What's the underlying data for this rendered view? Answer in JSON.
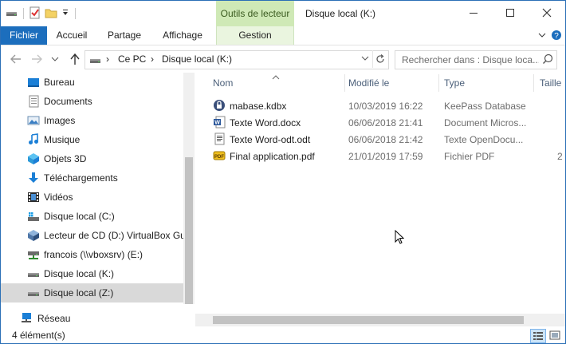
{
  "title_bar": {
    "context_tab": "Outils de lecteur",
    "window_title": "Disque local (K:)",
    "qat_icons": [
      "drive-icon",
      "properties-check-icon",
      "new-folder-icon",
      "customize-qat-icon"
    ]
  },
  "ribbon": {
    "tabs": [
      {
        "label": "Fichier"
      },
      {
        "label": "Accueil"
      },
      {
        "label": "Partage"
      },
      {
        "label": "Affichage"
      },
      {
        "label": "Gestion"
      }
    ]
  },
  "address": {
    "crumbs": [
      "Ce PC",
      "Disque local (K:)"
    ],
    "search_placeholder": "Rechercher dans : Disque loca..."
  },
  "nav_pane": {
    "items": [
      {
        "label": "Bureau",
        "icon": "desktop-icon"
      },
      {
        "label": "Documents",
        "icon": "documents-icon"
      },
      {
        "label": "Images",
        "icon": "images-icon"
      },
      {
        "label": "Musique",
        "icon": "music-icon"
      },
      {
        "label": "Objets 3D",
        "icon": "3d-objects-icon"
      },
      {
        "label": "Téléchargements",
        "icon": "downloads-icon"
      },
      {
        "label": "Vidéos",
        "icon": "videos-icon"
      },
      {
        "label": "Disque local (C:)",
        "icon": "windows-drive-icon"
      },
      {
        "label": "Lecteur de CD (D:) VirtualBox Gue",
        "icon": "cd-drive-icon"
      },
      {
        "label": "francois (\\\\vboxsrv) (E:)",
        "icon": "network-drive-icon"
      },
      {
        "label": "Disque local (K:)",
        "icon": "drive-icon"
      },
      {
        "label": "Disque local (Z:)",
        "icon": "drive-icon",
        "selected": true
      }
    ],
    "network": {
      "label": "Réseau",
      "icon": "network-icon"
    }
  },
  "columns": [
    "Nom",
    "Modifié le",
    "Type",
    "Taille"
  ],
  "files": [
    {
      "name": "mabase.kdbx",
      "modified": "10/03/2019 16:22",
      "type": "KeePass Database",
      "size": "",
      "icon": "keepass-icon"
    },
    {
      "name": "Texte Word.docx",
      "modified": "06/06/2018 21:41",
      "type": "Document Micros...",
      "size": "",
      "icon": "word-document-icon"
    },
    {
      "name": "Texte Word-odt.odt",
      "modified": "06/06/2018 21:42",
      "type": "Texte OpenDocu...",
      "size": "",
      "icon": "odt-document-icon"
    },
    {
      "name": "Final application.pdf",
      "modified": "21/01/2019 17:59",
      "type": "Fichier PDF",
      "size": "2",
      "icon": "pdf-icon"
    }
  ],
  "status": {
    "count": "4 élément(s)"
  }
}
